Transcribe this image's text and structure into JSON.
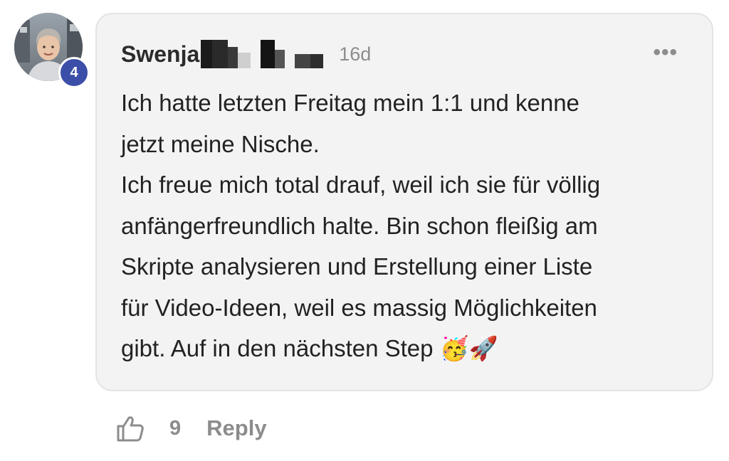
{
  "comment": {
    "author": {
      "name": "Swenja",
      "level": "4",
      "avatar_icon": "user-avatar-photo"
    },
    "time_ago": "16d",
    "more_icon": "more-options-icon",
    "more_label": "•••",
    "text_lines": [
      "Ich hatte letzten Freitag mein 1:1 und kenne",
      "jetzt meine Nische.",
      "Ich freue mich total drauf, weil ich sie für völlig",
      "anfängerfreundlich halte. Bin schon fleißig am",
      "Skripte analysieren und Erstellung einer Liste",
      "für Video-Ideen, weil es massig Möglichkeiten",
      "gibt. Auf in den nächsten Step 🥳🚀"
    ]
  },
  "actions": {
    "like_icon": "thumbs-up-icon",
    "like_count": "9",
    "reply_label": "Reply"
  },
  "colors": {
    "bubble_background": "#f4f3f3",
    "badge": "#3b4fa8",
    "muted_text": "#8c8c8c",
    "body_text": "#222222"
  }
}
